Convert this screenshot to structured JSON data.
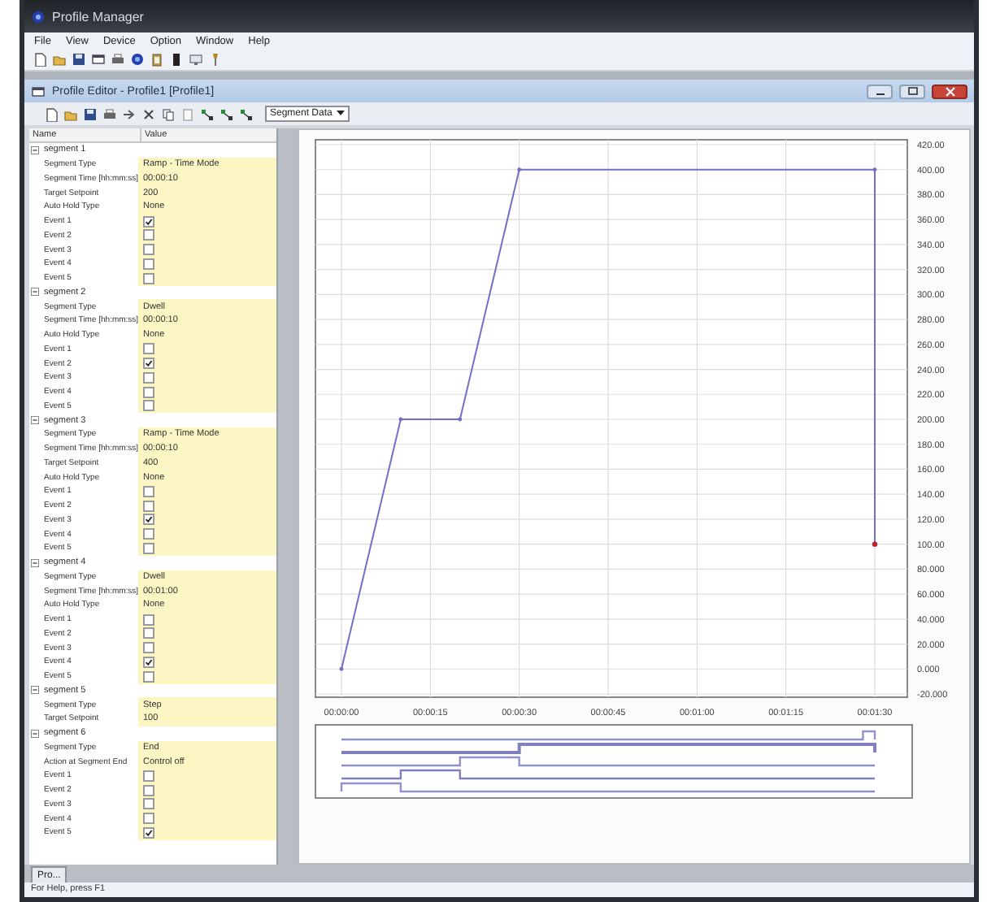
{
  "app": {
    "title": "Profile Manager"
  },
  "menu": [
    "File",
    "View",
    "Device",
    "Option",
    "Window",
    "Help"
  ],
  "child_window": {
    "title": "Profile Editor - Profile1 [Profile1]",
    "view_select": "Segment Data"
  },
  "tree": {
    "columns": [
      "Name",
      "Value"
    ],
    "segments": [
      {
        "label": "segment 1",
        "expanded": true,
        "children": [
          {
            "name": "Segment Type",
            "kind": "text",
            "value": "Ramp - Time Mode"
          },
          {
            "name": "Segment Time [hh:mm:ss]",
            "kind": "text",
            "value": "00:00:10"
          },
          {
            "name": "Target Setpoint",
            "kind": "text",
            "value": "200"
          },
          {
            "name": "Auto Hold Type",
            "kind": "text",
            "value": "None"
          },
          {
            "name": "Event 1",
            "kind": "checkbox",
            "checked": true
          },
          {
            "name": "Event 2",
            "kind": "checkbox",
            "checked": false
          },
          {
            "name": "Event 3",
            "kind": "checkbox",
            "checked": false
          },
          {
            "name": "Event 4",
            "kind": "checkbox",
            "checked": false
          },
          {
            "name": "Event 5",
            "kind": "checkbox",
            "checked": false
          }
        ]
      },
      {
        "label": "segment 2",
        "expanded": true,
        "children": [
          {
            "name": "Segment Type",
            "kind": "text",
            "value": "Dwell"
          },
          {
            "name": "Segment Time [hh:mm:ss]",
            "kind": "text",
            "value": "00:00:10"
          },
          {
            "name": "Auto Hold Type",
            "kind": "text",
            "value": "None"
          },
          {
            "name": "Event 1",
            "kind": "checkbox",
            "checked": false
          },
          {
            "name": "Event 2",
            "kind": "checkbox",
            "checked": true
          },
          {
            "name": "Event 3",
            "kind": "checkbox",
            "checked": false
          },
          {
            "name": "Event 4",
            "kind": "checkbox",
            "checked": false
          },
          {
            "name": "Event 5",
            "kind": "checkbox",
            "checked": false
          }
        ]
      },
      {
        "label": "segment 3",
        "expanded": true,
        "children": [
          {
            "name": "Segment Type",
            "kind": "text",
            "value": "Ramp - Time Mode"
          },
          {
            "name": "Segment Time [hh:mm:ss]",
            "kind": "text",
            "value": "00:00:10"
          },
          {
            "name": "Target Setpoint",
            "kind": "text",
            "value": "400"
          },
          {
            "name": "Auto Hold Type",
            "kind": "text",
            "value": "None"
          },
          {
            "name": "Event 1",
            "kind": "checkbox",
            "checked": false
          },
          {
            "name": "Event 2",
            "kind": "checkbox",
            "checked": false
          },
          {
            "name": "Event 3",
            "kind": "checkbox",
            "checked": true
          },
          {
            "name": "Event 4",
            "kind": "checkbox",
            "checked": false
          },
          {
            "name": "Event 5",
            "kind": "checkbox",
            "checked": false
          }
        ]
      },
      {
        "label": "segment 4",
        "expanded": true,
        "children": [
          {
            "name": "Segment Type",
            "kind": "text",
            "value": "Dwell"
          },
          {
            "name": "Segment Time [hh:mm:ss]",
            "kind": "text",
            "value": "00:01:00"
          },
          {
            "name": "Auto Hold Type",
            "kind": "text",
            "value": "None"
          },
          {
            "name": "Event 1",
            "kind": "checkbox",
            "checked": false
          },
          {
            "name": "Event 2",
            "kind": "checkbox",
            "checked": false
          },
          {
            "name": "Event 3",
            "kind": "checkbox",
            "checked": false
          },
          {
            "name": "Event 4",
            "kind": "checkbox",
            "checked": true
          },
          {
            "name": "Event 5",
            "kind": "checkbox",
            "checked": false
          }
        ]
      },
      {
        "label": "segment 5",
        "expanded": true,
        "children": [
          {
            "name": "Segment Type",
            "kind": "text",
            "value": "Step"
          },
          {
            "name": "Target Setpoint",
            "kind": "text",
            "value": "100"
          }
        ]
      },
      {
        "label": "segment 6",
        "expanded": true,
        "children": [
          {
            "name": "Segment Type",
            "kind": "text",
            "value": "End"
          },
          {
            "name": "Action at Segment End",
            "kind": "text",
            "value": "Control off"
          },
          {
            "name": "Event 1",
            "kind": "checkbox",
            "checked": false
          },
          {
            "name": "Event 2",
            "kind": "checkbox",
            "checked": false
          },
          {
            "name": "Event 3",
            "kind": "checkbox",
            "checked": false
          },
          {
            "name": "Event 4",
            "kind": "checkbox",
            "checked": false
          },
          {
            "name": "Event 5",
            "kind": "checkbox",
            "checked": true
          }
        ]
      }
    ]
  },
  "chart": {
    "chart_data": {
      "type": "line",
      "x": [
        0,
        10,
        20,
        30,
        90,
        90
      ],
      "grid": true,
      "series": [
        {
          "color": "#7070c8",
          "values": [
            0,
            200,
            200,
            400,
            400,
            100
          ]
        }
      ],
      "xlim": [
        0,
        90
      ],
      "ylim": [
        -20,
        420
      ],
      "xticks": [
        {
          "value": 0,
          "label": "00:00:00"
        },
        {
          "value": 15,
          "label": "00:00:15"
        },
        {
          "value": 30,
          "label": "00:00:30"
        },
        {
          "value": 45,
          "label": "00:00:45"
        },
        {
          "value": 60,
          "label": "00:01:00"
        },
        {
          "value": 75,
          "label": "00:01:15"
        },
        {
          "value": 90,
          "label": "00:01:30"
        }
      ],
      "yticks": [
        {
          "value": 420,
          "label": "420.00"
        },
        {
          "value": 400,
          "label": "400.00"
        },
        {
          "value": 380,
          "label": "380.00"
        },
        {
          "value": 360,
          "label": "360.00"
        },
        {
          "value": 340,
          "label": "340.00"
        },
        {
          "value": 320,
          "label": "320.00"
        },
        {
          "value": 300,
          "label": "300.00"
        },
        {
          "value": 280,
          "label": "280.00"
        },
        {
          "value": 260,
          "label": "260.00"
        },
        {
          "value": 240,
          "label": "240.00"
        },
        {
          "value": 220,
          "label": "220.00"
        },
        {
          "value": 200,
          "label": "200.00"
        },
        {
          "value": 180,
          "label": "180.00"
        },
        {
          "value": 160,
          "label": "160.00"
        },
        {
          "value": 140,
          "label": "140.00"
        },
        {
          "value": 120,
          "label": "120.00"
        },
        {
          "value": 100,
          "label": "100.00"
        },
        {
          "value": 80,
          "label": "80.000"
        },
        {
          "value": 60,
          "label": "60.000"
        },
        {
          "value": 40,
          "label": "40.000"
        },
        {
          "value": 20,
          "label": "20.000"
        },
        {
          "value": 0,
          "label": "0.000"
        },
        {
          "value": -20,
          "label": "-20.000"
        }
      ]
    }
  },
  "tabs": [
    {
      "label": "Pro...",
      "selected": true
    }
  ],
  "status_bar": "For Help, press F1"
}
